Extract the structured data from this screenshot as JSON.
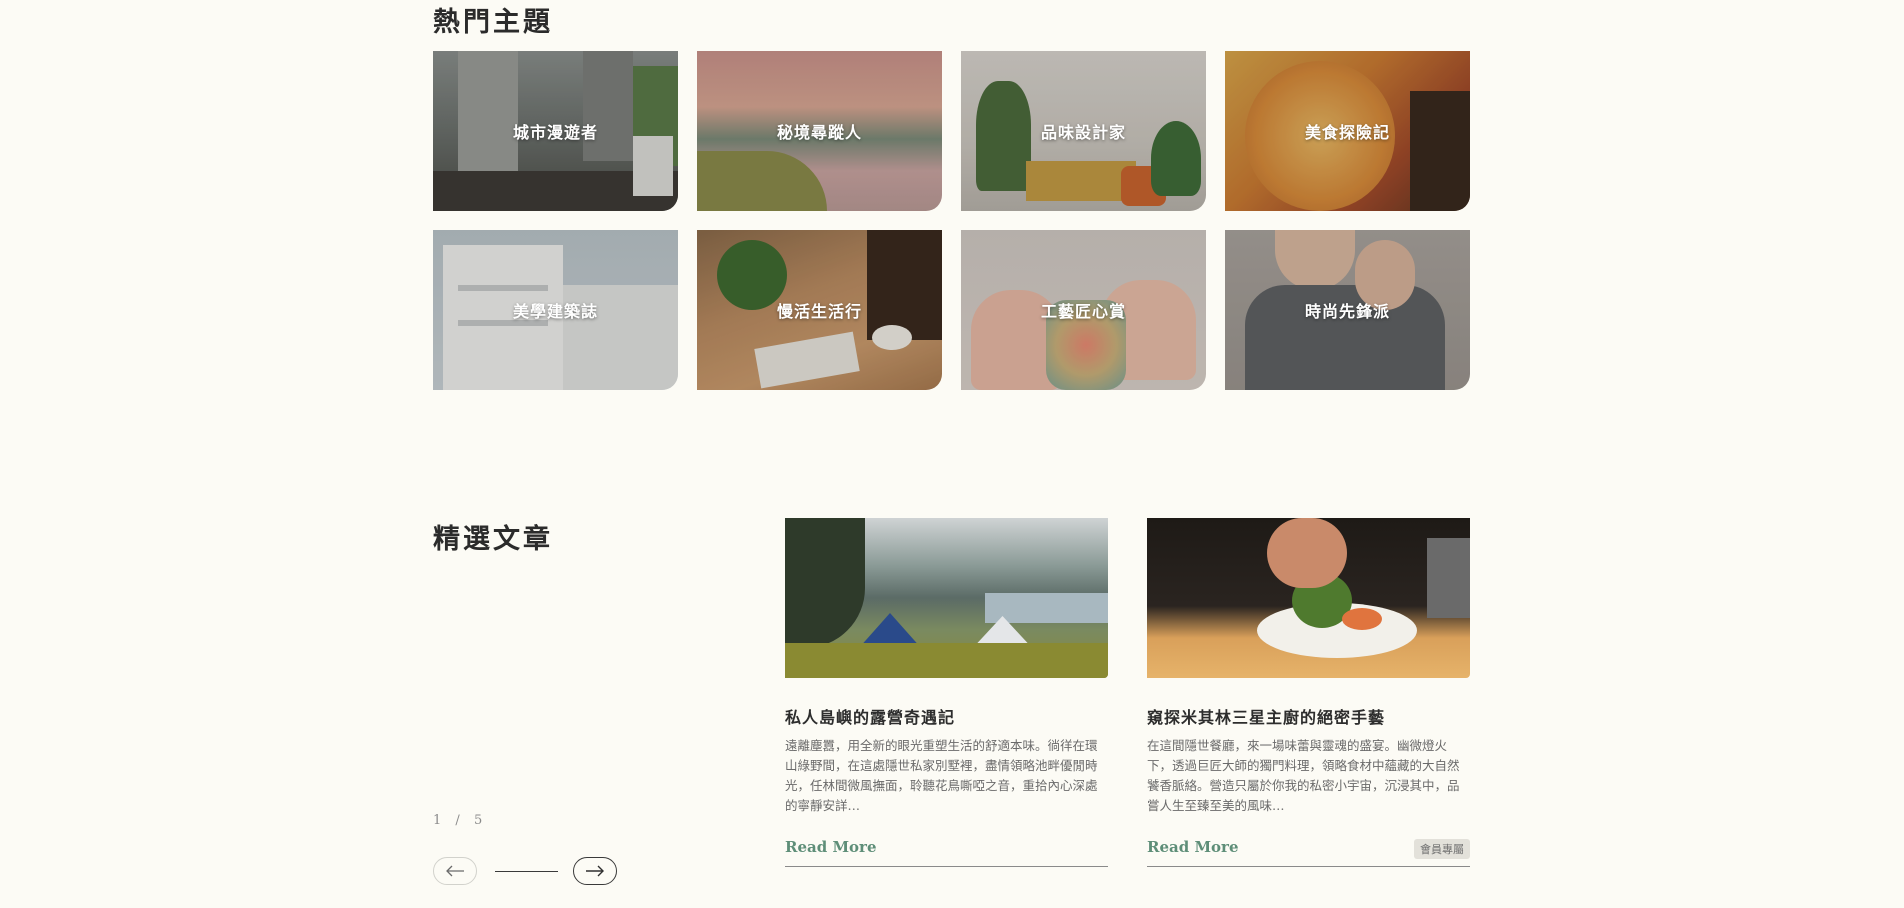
{
  "hot_topics": {
    "title": "熱門主題",
    "items": [
      {
        "label": "城市漫遊者"
      },
      {
        "label": "秘境尋蹤人"
      },
      {
        "label": "品味設計家"
      },
      {
        "label": "美食探險記"
      },
      {
        "label": "美學建築誌"
      },
      {
        "label": "慢活生活行"
      },
      {
        "label": "工藝匠心賞"
      },
      {
        "label": "時尚先鋒派"
      }
    ]
  },
  "featured": {
    "title": "精選文章",
    "pager": {
      "current": "1",
      "separator": "/",
      "total": "5"
    },
    "articles": [
      {
        "title": "私人島嶼的露營奇遇記",
        "excerpt": "遠離塵囂，用全新的眼光重塑生活的舒適本味。徜徉在環山綠野間，在這處隱世私家別墅裡，盡情領略池畔優閒時光，任林間微風撫面，聆聽花鳥嘶啞之音，重拾內心深處的寧靜安詳…",
        "read_more": "Read More",
        "badge": ""
      },
      {
        "title": "窺探米其林三星主廚的絕密手藝",
        "excerpt": "在這間隱世餐廳，來一場味蕾與靈魂的盛宴。幽微燈火下，透過巨匠大師的獨門料理，領略食材中蘊藏的大自然饕香脈絡。營造只屬於你我的私密小宇宙，沉浸其中，品嘗人生至臻至美的風味…",
        "read_more": "Read More",
        "badge": "會員專屬"
      }
    ]
  },
  "colors": {
    "background": "#fcfbf5",
    "accent_green": "#5e8e78",
    "text_dark": "#2b2b2b"
  },
  "icons": {
    "prev": "arrow-left-icon",
    "next": "arrow-right-icon"
  }
}
